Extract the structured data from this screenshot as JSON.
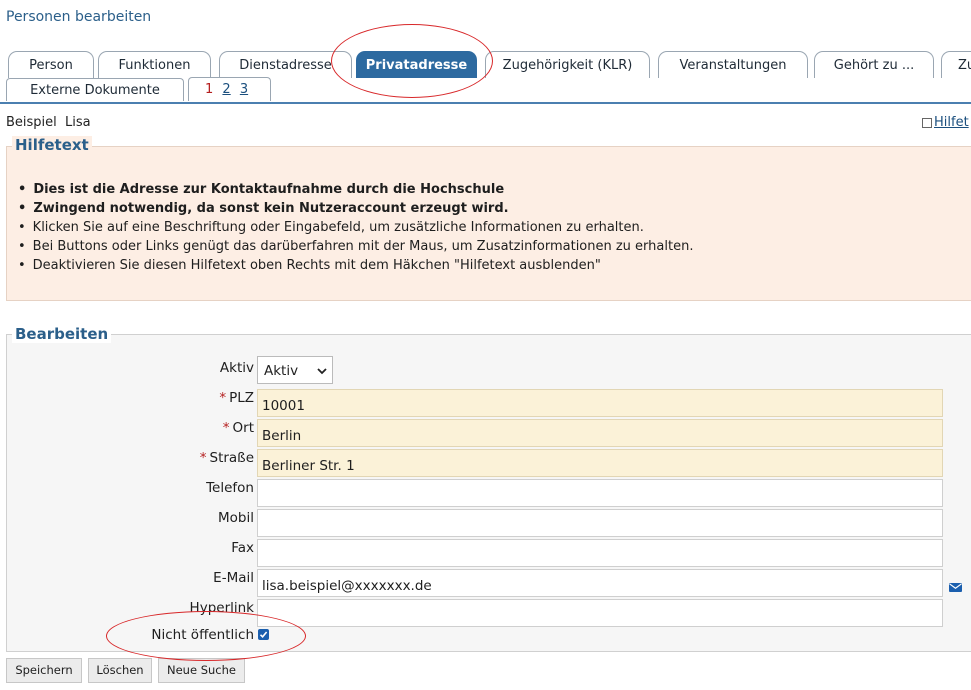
{
  "page": {
    "title": "Personen bearbeiten"
  },
  "tabs": [
    {
      "label": "Person"
    },
    {
      "label": "Funktionen"
    },
    {
      "label": "Dienstadresse"
    },
    {
      "label": "Privatadresse",
      "active": true
    },
    {
      "label": "Zugehörigkeit (KLR)"
    },
    {
      "label": "Veranstaltungen"
    },
    {
      "label": "Gehört zu ..."
    },
    {
      "label": "Zu"
    },
    {
      "label": "Externe Dokumente"
    }
  ],
  "pager": {
    "current": "1",
    "pages": [
      "2",
      "3"
    ]
  },
  "person": {
    "name": "Beispiel  Lisa"
  },
  "help_toggle": {
    "label": "Hilfet"
  },
  "help": {
    "legend": "Hilfetext",
    "items": [
      {
        "text": "Dies ist die Adresse zur Kontaktaufnahme durch die Hochschule",
        "bold": true
      },
      {
        "text": "Zwingend notwendig, da sonst kein Nutzeraccount erzeugt wird.",
        "bold": true
      },
      {
        "text": "Klicken Sie auf eine Beschriftung oder Eingabefeld, um zusätzliche Informationen zu erhalten.",
        "bold": false
      },
      {
        "text": "Bei Buttons oder Links genügt das darüberfahren mit der Maus, um Zusatzinformationen zu erhalten.",
        "bold": false
      },
      {
        "text": "Deaktivieren Sie diesen Hilfetext oben Rechts mit dem Häkchen \"Hilfetext ausblenden\"",
        "bold": false
      }
    ]
  },
  "form": {
    "legend": "Bearbeiten",
    "aktiv": {
      "label": "Aktiv",
      "value": "Aktiv"
    },
    "plz": {
      "label": "PLZ",
      "value": "10001",
      "required_marker": "*"
    },
    "ort": {
      "label": "Ort",
      "value": "Berlin",
      "required_marker": "*"
    },
    "strasse": {
      "label": "Straße",
      "value": "Berliner Str. 1",
      "required_marker": "*"
    },
    "telefon": {
      "label": "Telefon",
      "value": ""
    },
    "mobil": {
      "label": "Mobil",
      "value": ""
    },
    "fax": {
      "label": "Fax",
      "value": ""
    },
    "email": {
      "label": "E-Mail",
      "value": "lisa.beispiel@xxxxxxx.de"
    },
    "hyperlink": {
      "label": "Hyperlink",
      "value": ""
    },
    "nicht_oeffentlich": {
      "label": "Nicht öffentlich",
      "checked": true
    }
  },
  "buttons": {
    "save": "Speichern",
    "delete": "Löschen",
    "new_search": "Neue Suche"
  },
  "colors": {
    "accent": "#2d6aa0",
    "required_field_bg": "#fbf2d8",
    "help_bg": "#fdeee4",
    "annotation": "#d8282a"
  }
}
